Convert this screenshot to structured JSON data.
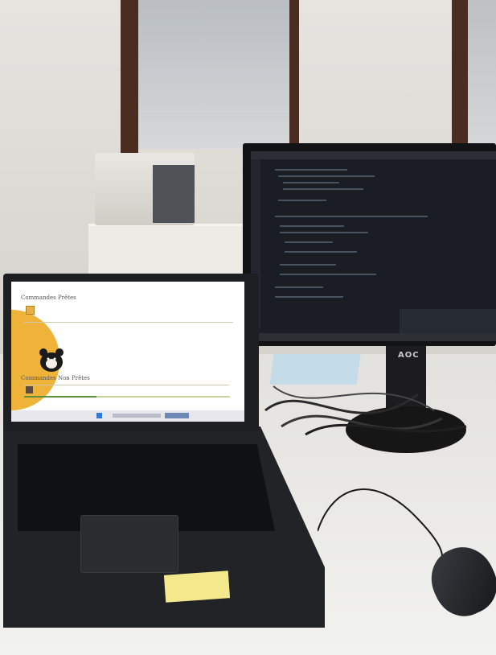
{
  "laptop_screen": {
    "heading_ready": "Commandes Prêtes",
    "heading_not_ready": "Commandes Non Prêtes"
  },
  "monitor": {
    "brand": "AOC"
  },
  "colors": {
    "accent_orange": "#f0b33a",
    "progress_green": "#5b8f3c",
    "sticky_note": "#f3e98c"
  },
  "icons": [
    "penguin-mascot-icon",
    "order-box-icon",
    "windows-start-icon"
  ]
}
